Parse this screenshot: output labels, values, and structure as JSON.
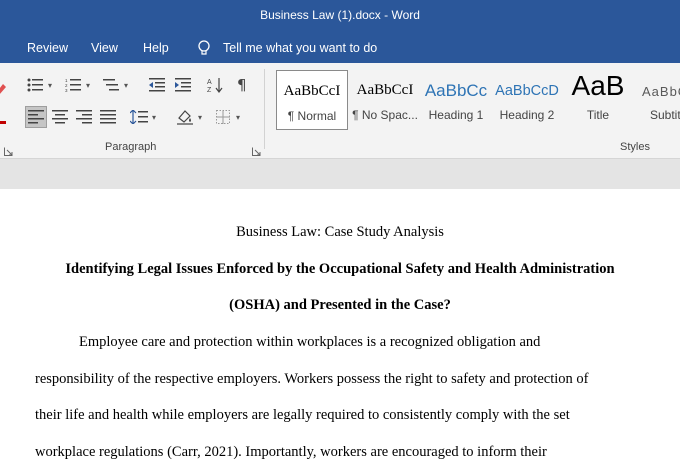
{
  "window": {
    "title": "Business Law (1).docx  -  Word"
  },
  "menu": {
    "review": "Review",
    "view": "View",
    "help": "Help",
    "tell_me": "Tell me what you want to do"
  },
  "ribbon": {
    "paragraph_label": "Paragraph",
    "styles_label": "Styles",
    "styles": [
      {
        "sample": "AaBbCcI",
        "name": "¶ Normal"
      },
      {
        "sample": "AaBbCcI",
        "name": "¶ No Spac..."
      },
      {
        "sample": "AaBbCc",
        "name": "Heading 1"
      },
      {
        "sample": "AaBbCcD",
        "name": "Heading 2"
      },
      {
        "sample": "AaB",
        "name": "Title"
      },
      {
        "sample": "AaBbC",
        "name": "Subtitle"
      }
    ]
  },
  "document": {
    "course_title": "Business Law: Case Study Analysis",
    "heading_line1": "Identifying Legal Issues Enforced by the Occupational Safety and Health Administration",
    "heading_line2": "(OSHA) and Presented in the Case?",
    "body": [
      "Employee care and protection within workplaces is a recognized obligation and",
      "responsibility of the respective employers. Workers possess the right to safety and protection of",
      "their life and health while employers are legally required to consistently comply with the set",
      "workplace regulations (Carr, 2021). Importantly, workers are encouraged to inform their"
    ]
  },
  "colors": {
    "title_bar": "#2b579a",
    "heading_style": "#2e74b5",
    "ribbon": "#f3f3f3"
  }
}
